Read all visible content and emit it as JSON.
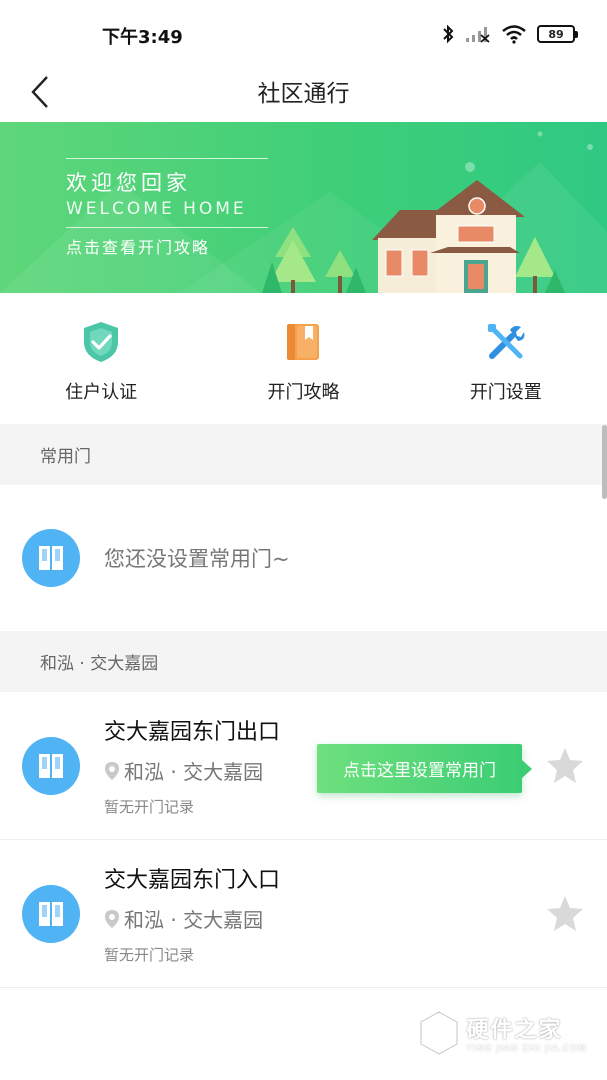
{
  "status_bar": {
    "time": "下午3:49",
    "battery": "89"
  },
  "nav": {
    "title": "社区通行"
  },
  "banner": {
    "title": "欢迎您回家",
    "subtitle": "WELCOME HOME",
    "link": "点击查看开门攻略"
  },
  "quick_actions": [
    {
      "label": "住户认证",
      "icon": "shield-check-icon"
    },
    {
      "label": "开门攻略",
      "icon": "book-icon"
    },
    {
      "label": "开门设置",
      "icon": "tools-icon"
    }
  ],
  "common_doors": {
    "header": "常用门",
    "empty_text": "您还没设置常用门~"
  },
  "community": {
    "header": "和泓 · 交大嘉园",
    "doors": [
      {
        "name": "交大嘉园东门出口",
        "location": "和泓 · 交大嘉园",
        "record": "暂无开门记录"
      },
      {
        "name": "交大嘉园东门入口",
        "location": "和泓 · 交大嘉园",
        "record": "暂无开门记录"
      }
    ]
  },
  "tooltip": {
    "text": "点击这里设置常用门"
  },
  "watermark": {
    "main": "硬件之家",
    "sub": "YING JIAN ZHI JIA.COM"
  },
  "colors": {
    "accent_green": "#3fcf78",
    "door_blue": "#4fb3f4",
    "star_gray": "#d9d9d9"
  }
}
